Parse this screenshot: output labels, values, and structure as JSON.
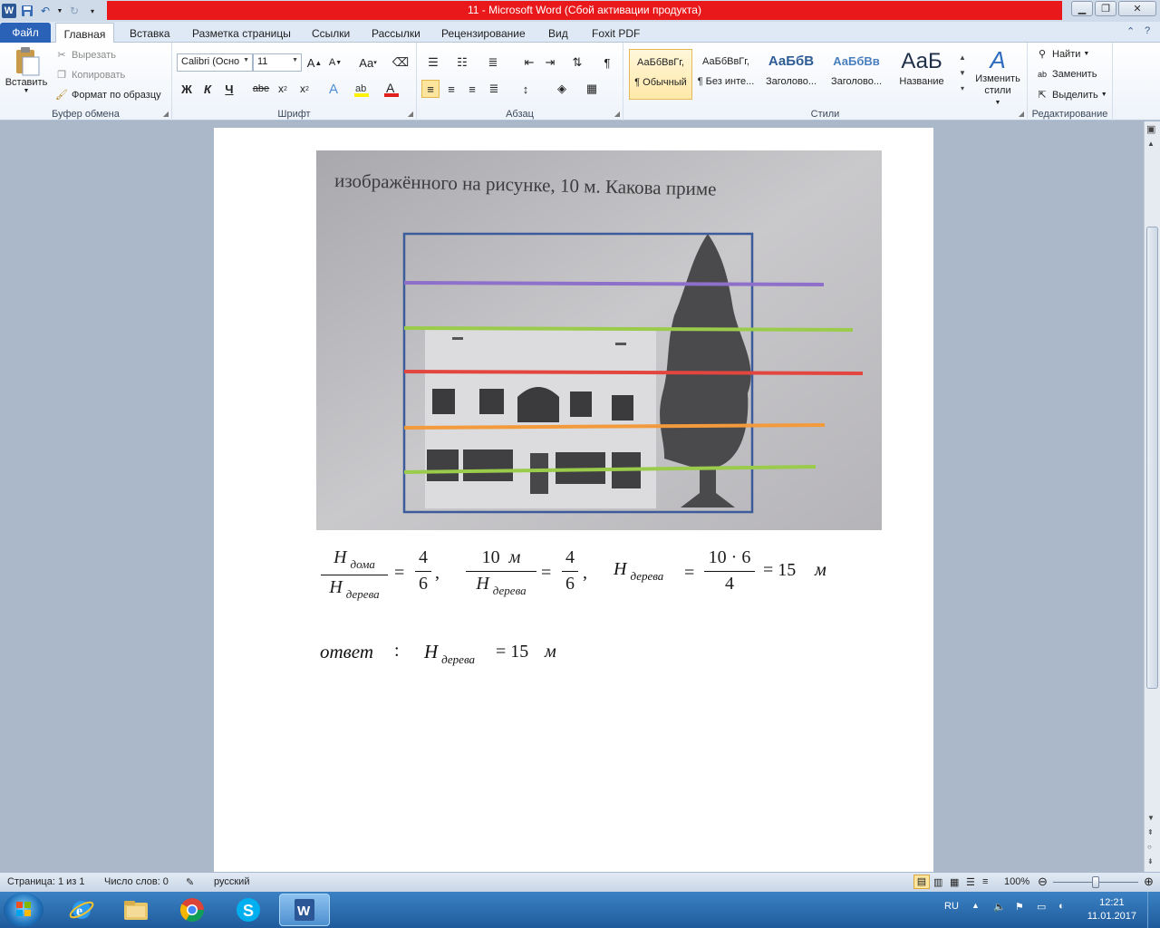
{
  "window": {
    "title": "11  -  Microsoft Word (Сбой активации продукта)",
    "app_icon_letter": "W"
  },
  "tabs": [
    {
      "label": "Файл",
      "left": 0
    },
    {
      "label": "Главная"
    },
    {
      "label": "Вставка"
    },
    {
      "label": "Разметка страницы"
    },
    {
      "label": "Ссылки"
    },
    {
      "label": "Рассылки"
    },
    {
      "label": "Рецензирование"
    },
    {
      "label": "Вид"
    },
    {
      "label": "Foxit PDF"
    }
  ],
  "ribbon": {
    "clipboard": {
      "label": "Буфер обмена",
      "paste": "Вставить",
      "cut": "Вырезать",
      "copy": "Копировать",
      "format_painter": "Формат по образцу"
    },
    "font": {
      "label": "Шрифт",
      "font_name": "Calibri (Осно",
      "font_size": "11",
      "bold": "Ж",
      "italic": "К",
      "underline": "Ч",
      "strike": "abe"
    },
    "paragraph": {
      "label": "Абзац"
    },
    "styles": {
      "label": "Стили",
      "items": [
        {
          "sample": "АаБбВвГг,",
          "name": "¶ Обычный"
        },
        {
          "sample": "АаБбВвГг,",
          "name": "¶ Без инте..."
        },
        {
          "sample": "АаБбВ",
          "name": "Заголово..."
        },
        {
          "sample": "АаБбВв",
          "name": "Заголово..."
        },
        {
          "sample": "АаБ",
          "name": "Название"
        }
      ],
      "change_styles": "Изменить стили"
    },
    "editing": {
      "label": "Редактирование",
      "find": "Найти",
      "replace": "Заменить",
      "select": "Выделить"
    }
  },
  "document": {
    "photo_caption_text": "изображённого  на  рисунке,  10 м.  Какова  приме",
    "formula1": {
      "frac1_num": "H",
      "frac1_num_sub": "дома",
      "frac1_den": "H",
      "frac1_den_sub": "дерева",
      "eq1": "=",
      "frac2_num": "4",
      "frac2_den": "6",
      "comma1": ",",
      "frac3_num": "10",
      "frac3_num_unit": "м",
      "frac3_den": "H",
      "frac3_den_sub": "дерева",
      "eq2": "=",
      "frac4_num": "4",
      "frac4_den": "6",
      "comma2": ",",
      "lhs": "H",
      "lhs_sub": "дерева",
      "eq3": "=",
      "frac5_num": "10 · 6",
      "frac5_den": "4",
      "result": "= 15",
      "result_unit": "м"
    },
    "answer": {
      "label": "ответ",
      "colon": ":",
      "var": "H",
      "var_sub": "дерева",
      "value": "= 15",
      "unit": "м"
    }
  },
  "status": {
    "page": "Страница: 1 из 1",
    "words": "Число слов: 0",
    "language": "русский",
    "zoom": "100%",
    "zoom_level_percent": 100
  },
  "taskbar": {
    "lang": "RU",
    "time": "12:21",
    "date": "11.01.2017"
  },
  "colors": {
    "title_red": "#e8181b",
    "file_tab": "#2a62b8",
    "line_purple": "#8e6fc9",
    "line_green": "#9acb4a",
    "line_red": "#e2463f",
    "line_orange": "#f29a3c",
    "frame_blue": "#3b5b9a"
  }
}
